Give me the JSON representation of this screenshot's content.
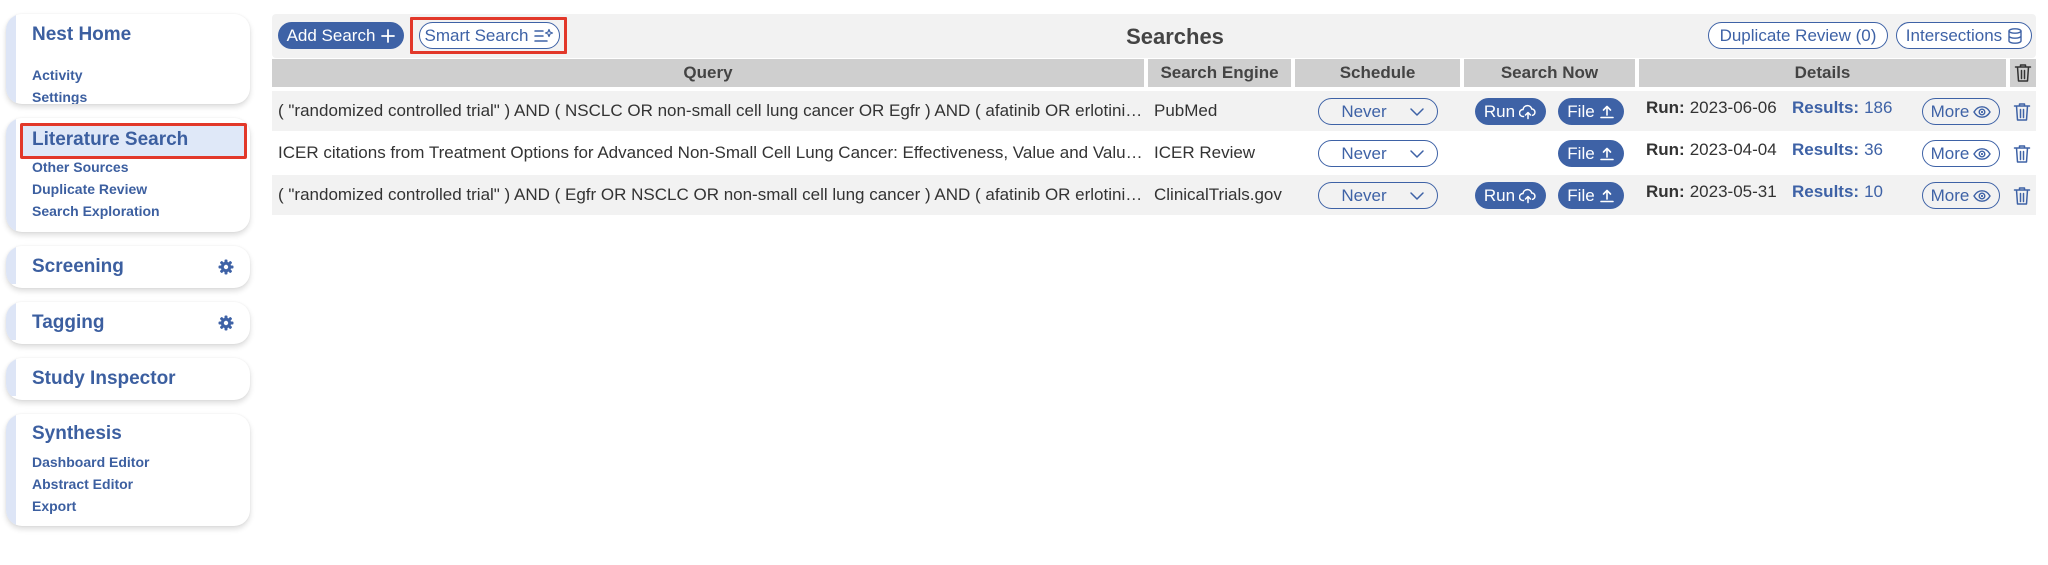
{
  "sidebar": {
    "home": {
      "title": "Nest Home",
      "items": [
        "Activity",
        "Settings"
      ]
    },
    "literature": {
      "title": "Literature Search",
      "items": [
        "Other Sources",
        "Duplicate Review",
        "Search Exploration"
      ]
    },
    "screening": {
      "title": "Screening"
    },
    "tagging": {
      "title": "Tagging"
    },
    "inspector": {
      "title": "Study Inspector"
    },
    "synthesis": {
      "title": "Synthesis",
      "items": [
        "Dashboard Editor",
        "Abstract Editor",
        "Export"
      ]
    }
  },
  "toolbar": {
    "add_search": "Add Search",
    "smart_search": "Smart Search",
    "title": "Searches",
    "duplicate_review": "Duplicate Review (0)",
    "intersections": "Intersections"
  },
  "table": {
    "headers": {
      "query": "Query",
      "engine": "Search Engine",
      "schedule": "Schedule",
      "search_now": "Search Now",
      "details": "Details"
    },
    "run_label": "Run:",
    "results_label": "Results:",
    "run_button": "Run",
    "file_button": "File",
    "more_button": "More",
    "rows": [
      {
        "query": "( \"randomized controlled trial\" ) AND ( NSCLC OR non-small cell lung cancer OR Egfr ) AND ( afatinib OR erlotinib OR gefitinib OR osimertinib )",
        "engine": "PubMed",
        "schedule": "Never",
        "has_run": true,
        "run_date": "2023-06-06",
        "results": "186"
      },
      {
        "query": "ICER citations from Treatment Options for Advanced Non-Small Cell Lung Cancer: Effectiveness, Value and Value-Based Price Benchmarks",
        "engine": "ICER Review",
        "schedule": "Never",
        "has_run": false,
        "run_date": "2023-04-04",
        "results": "36"
      },
      {
        "query": "( \"randomized controlled trial\" ) AND ( Egfr OR NSCLC OR non-small cell lung cancer ) AND ( afatinib OR erlotinib OR gefitinib OR osimertinib )",
        "engine": "ClinicalTrials.gov",
        "schedule": "Never",
        "has_run": true,
        "run_date": "2023-05-31",
        "results": "10"
      }
    ]
  },
  "colors": {
    "accent": "#3e62a6",
    "highlight": "#e2382a",
    "active_bg": "#dfe8f8"
  }
}
